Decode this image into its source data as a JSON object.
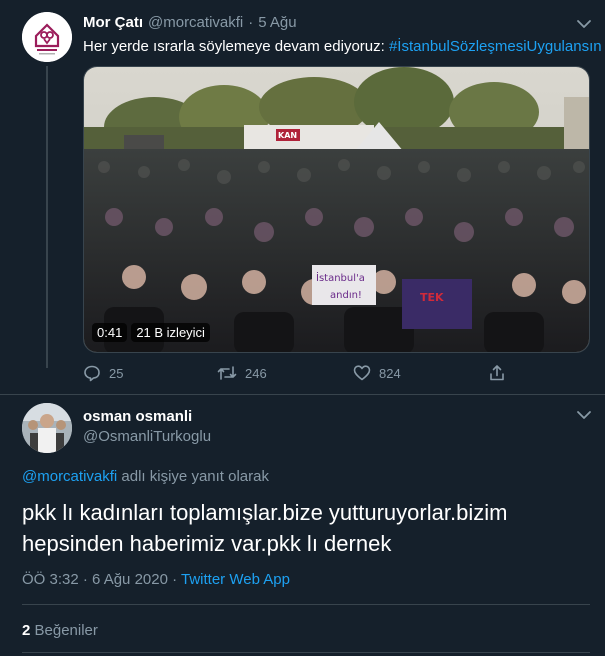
{
  "tweet1": {
    "name": "Mor Çatı",
    "handle": "@morcativakfi",
    "sep": "·",
    "date": "5 Ağu",
    "text": "Her yerde ısrarla söylemeye devam ediyoruz: ",
    "hashtag": "#İstanbulSözleşmesiUygulansın",
    "video": {
      "duration": "0:41",
      "views": "21 B izleyici",
      "sign_text": "İstanbul'a",
      "sign_text2": "andın!",
      "banner_text": "TEK",
      "tent_text": "KAN"
    },
    "actions": {
      "replies": "25",
      "retweets": "246",
      "likes": "824"
    },
    "avatar_text": "MOR ÇATI"
  },
  "tweet2": {
    "name": "osman osmanli",
    "handle": "@OsmanliTurkoglu",
    "reply_handle": "@morcativakfi",
    "reply_suffix": " adlı kişiye yanıt olarak",
    "text_line1": "pkk lı kadınları toplamışlar.bize yutturuyorlar.bizim",
    "text_line2": "hepsinden haberimiz var.pkk lı dernek",
    "time": "ÖÖ 3:32 · 6 Ağu 2020 · ",
    "source": "Twitter Web App",
    "likes_count": "2",
    "likes_label": "Beğeniler"
  },
  "colors": {
    "background": "#15202b",
    "accent": "#1da1f2",
    "muted": "#8899a6",
    "divider": "#38444d"
  }
}
